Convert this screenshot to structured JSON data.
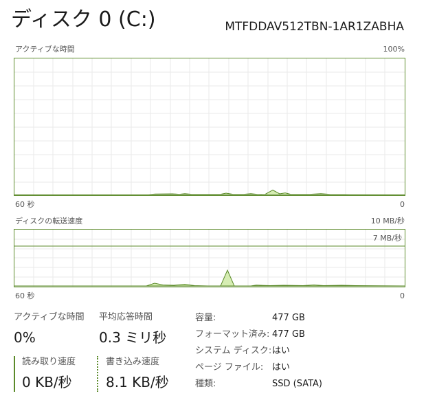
{
  "header": {
    "title": "ディスク 0 (C:)",
    "model": "MTFDDAV512TBN-1AR1ZABHA"
  },
  "active_time_graph": {
    "label": "アクティブな時間",
    "max_label": "100%",
    "time_label": "60 秒",
    "min_label": "0"
  },
  "transfer_graph": {
    "label": "ディスクの転送速度",
    "max_label": "10 MB/秒",
    "line_label": "7 MB/秒",
    "time_label": "60 秒",
    "min_label": "0"
  },
  "stats": {
    "active_time": {
      "label": "アクティブな時間",
      "value": "0%"
    },
    "avg_response": {
      "label": "平均応答時間",
      "value": "0.3 ミリ秒"
    },
    "read_speed": {
      "label": "読み取り速度",
      "value": "0 KB/秒"
    },
    "write_speed": {
      "label": "書き込み速度",
      "value": "8.1 KB/秒"
    }
  },
  "properties": [
    {
      "label": "容量:",
      "value": "477 GB"
    },
    {
      "label": "フォーマット済み:",
      "value": "477 GB"
    },
    {
      "label": "システム ディスク:",
      "value": "はい"
    },
    {
      "label": "ページ ファイル:",
      "value": "はい"
    },
    {
      "label": "種類:",
      "value": "SSD (SATA)"
    }
  ],
  "colors": {
    "accent": "#5b8a2a",
    "fill": "#d6edb3",
    "grid": "#eaeaea"
  }
}
